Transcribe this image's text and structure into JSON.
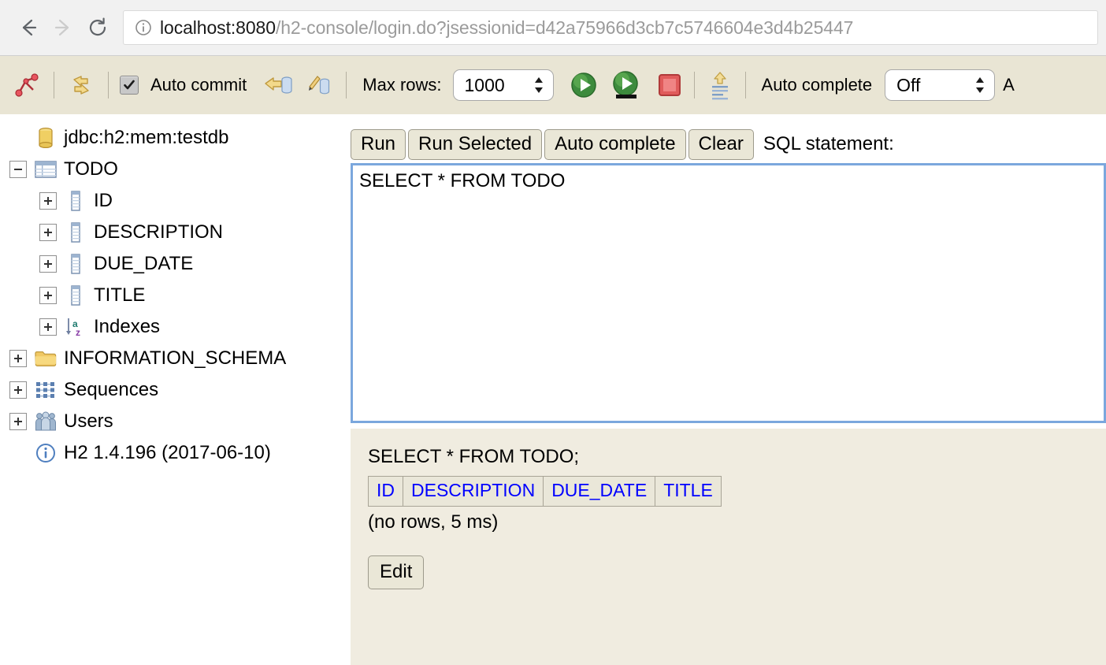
{
  "browser": {
    "back_label": "back-arrow",
    "forward_label": "forward-arrow",
    "reload_label": "reload",
    "url_host": "localhost:8080",
    "url_path": "/h2-console/login.do?jsessionid=d42a75966d3cb7c5746604e3d4b25447",
    "url_full": "localhost:8080/h2-console/login.do?jsessionid=d42a75966d3cb7c5746604e3d4b25447"
  },
  "toolbar": {
    "disconnect_icon": "disconnect-icon",
    "refresh_icon": "refresh-icon",
    "auto_commit_label": "Auto commit",
    "auto_commit_checked": true,
    "rollback_icon": "rollback-icon",
    "commit_icon": "commit-icon",
    "max_rows_label": "Max rows:",
    "max_rows_value": "1000",
    "run_icon": "run-icon",
    "run_selected_icon": "run-selected-icon",
    "stop_icon": "stop-icon",
    "history_icon": "history-icon",
    "auto_complete_label": "Auto complete",
    "auto_complete_value": "Off",
    "truncated_label": "A"
  },
  "tree": {
    "items": [
      {
        "label": "jdbc:h2:mem:testdb",
        "icon": "database-icon",
        "toggle": "none",
        "indent": 0
      },
      {
        "label": "TODO",
        "icon": "table-icon",
        "toggle": "minus",
        "indent": 0
      },
      {
        "label": "ID",
        "icon": "column-icon",
        "toggle": "plus",
        "indent": 1
      },
      {
        "label": "DESCRIPTION",
        "icon": "column-icon",
        "toggle": "plus",
        "indent": 1
      },
      {
        "label": "DUE_DATE",
        "icon": "column-icon",
        "toggle": "plus",
        "indent": 1
      },
      {
        "label": "TITLE",
        "icon": "column-icon",
        "toggle": "plus",
        "indent": 1
      },
      {
        "label": "Indexes",
        "icon": "sort-az-icon",
        "toggle": "plus",
        "indent": 1
      },
      {
        "label": "INFORMATION_SCHEMA",
        "icon": "folder-icon",
        "toggle": "plus",
        "indent": 0
      },
      {
        "label": "Sequences",
        "icon": "sequences-icon",
        "toggle": "plus",
        "indent": 0
      },
      {
        "label": "Users",
        "icon": "users-icon",
        "toggle": "plus",
        "indent": 0
      },
      {
        "label": "H2 1.4.196 (2017-06-10)",
        "icon": "info-icon",
        "toggle": "none",
        "indent": 0
      }
    ]
  },
  "sql": {
    "buttons": [
      "Run",
      "Run Selected",
      "Auto complete",
      "Clear"
    ],
    "statement_label": "SQL statement:",
    "statement_value": "SELECT * FROM TODO"
  },
  "result": {
    "query": "SELECT * FROM TODO;",
    "columns": [
      "ID",
      "DESCRIPTION",
      "DUE_DATE",
      "TITLE"
    ],
    "rows": [],
    "status": "(no rows, 5 ms)",
    "edit_label": "Edit"
  },
  "colors": {
    "toolbar_bg": "#e9e5d4",
    "result_bg": "#f0ece0",
    "textarea_border": "#7ba7dd",
    "header_link": "#0000ff"
  }
}
